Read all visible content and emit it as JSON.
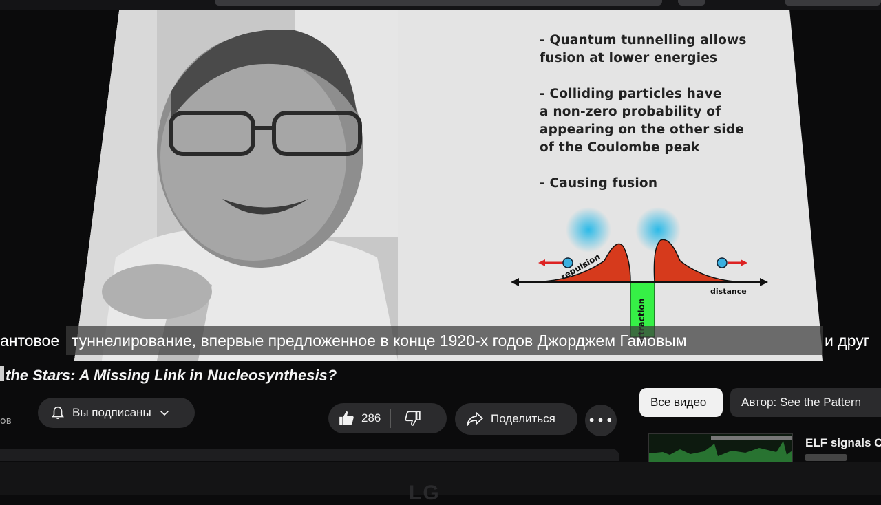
{
  "slide": {
    "bullets": [
      "- Quantum tunnelling allows\n  fusion at lower energies",
      "- Colliding particles have\n  a non-zero probability of\n  appearing on the other side\n  of the Coulombe peak",
      "- Causing fusion"
    ],
    "diagram": {
      "repulsion_label": "repulsion",
      "distance_label": "distance",
      "attraction_label": "attraction"
    }
  },
  "subtitle": {
    "prefix": "антовое",
    "band": "туннелирование, впервые предложенное в конце 1920-х годов Джорджем Гамовым",
    "suffix": "и друг"
  },
  "video": {
    "title": "the Stars: A Missing Link in Nucleosynthesis?",
    "channel_fragment": "ов",
    "subscribe_label": "Вы подписаны",
    "like_count": "286",
    "share_label": "Поделиться"
  },
  "chips": {
    "all_videos": "Все видео",
    "by_author": "Автор: See the Pattern"
  },
  "recommendation": {
    "title": "ELF signals C"
  },
  "tv": {
    "brand": "LG"
  }
}
